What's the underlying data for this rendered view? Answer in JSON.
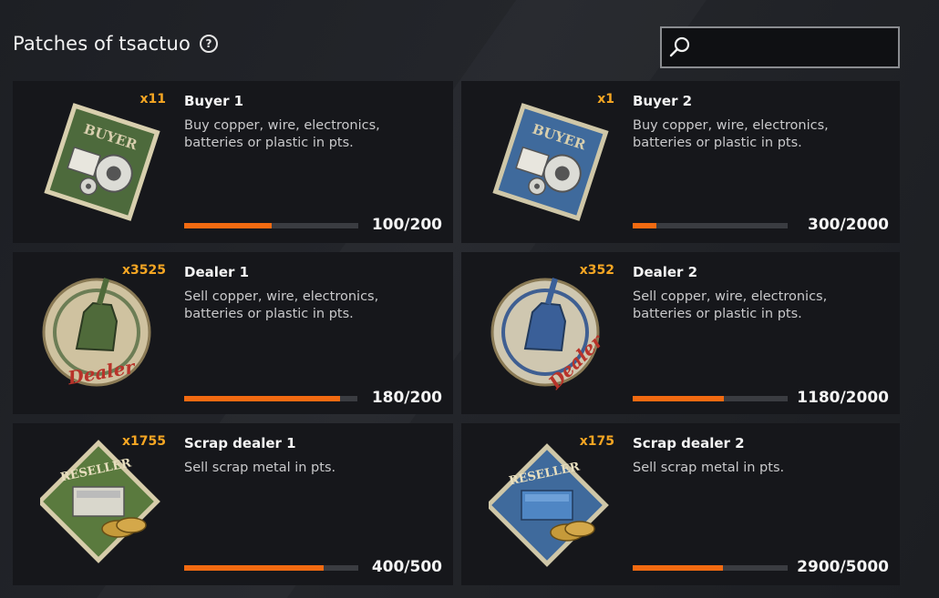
{
  "header": {
    "title": "Patches of tsactuo",
    "help_icon": "question-circle-icon",
    "search": {
      "value": "",
      "placeholder": "",
      "icon": "search-icon"
    }
  },
  "colors": {
    "accent": "#f26a11",
    "count": "#f5a623",
    "card_bg": "#16171b"
  },
  "patches": [
    {
      "count": "x11",
      "name": "Buyer 1",
      "desc": "Buy copper, wire, electronics, batteries or plastic in pts.",
      "progress": "100/200",
      "fraction": 0.5,
      "icon": "buyer-patch-green-icon"
    },
    {
      "count": "x1",
      "name": "Buyer 2",
      "desc": "Buy copper, wire, electronics, batteries or plastic in pts.",
      "progress": "300/2000",
      "fraction": 0.15,
      "icon": "buyer-patch-blue-icon"
    },
    {
      "count": "x3525",
      "name": "Dealer 1",
      "desc": "Sell copper, wire, electronics, batteries or plastic in pts.",
      "progress": "180/200",
      "fraction": 0.9,
      "icon": "dealer-patch-green-icon"
    },
    {
      "count": "x352",
      "name": "Dealer 2",
      "desc": "Sell copper, wire, electronics, batteries or plastic in pts.",
      "progress": "1180/2000",
      "fraction": 0.59,
      "icon": "dealer-patch-blue-icon"
    },
    {
      "count": "x1755",
      "name": "Scrap dealer 1",
      "desc": "Sell scrap metal in pts.",
      "progress": "400/500",
      "fraction": 0.8,
      "icon": "reseller-patch-green-icon"
    },
    {
      "count": "x175",
      "name": "Scrap dealer 2",
      "desc": "Sell scrap metal in pts.",
      "progress": "2900/5000",
      "fraction": 0.58,
      "icon": "reseller-patch-blue-icon"
    }
  ]
}
